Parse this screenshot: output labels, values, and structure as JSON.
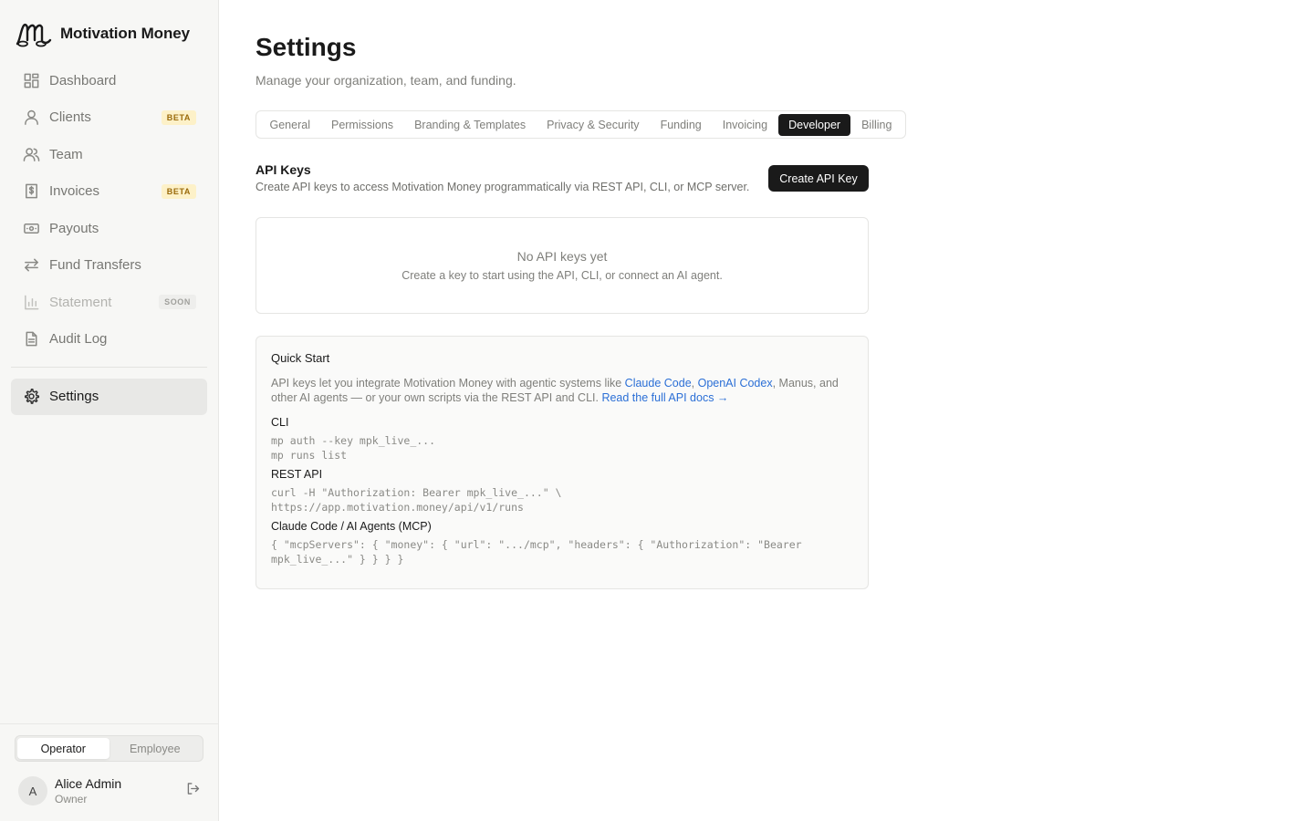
{
  "brand": {
    "name": "Motivation Money"
  },
  "sidebar": {
    "items": [
      {
        "label": "Dashboard",
        "icon": "dashboard-grid-icon",
        "badge": ""
      },
      {
        "label": "Clients",
        "icon": "user-icon",
        "badge": "BETA"
      },
      {
        "label": "Team",
        "icon": "users-icon",
        "badge": ""
      },
      {
        "label": "Invoices",
        "icon": "invoice-dollar-icon",
        "badge": "BETA"
      },
      {
        "label": "Payouts",
        "icon": "banknote-icon",
        "badge": ""
      },
      {
        "label": "Fund Transfers",
        "icon": "transfer-arrows-icon",
        "badge": ""
      },
      {
        "label": "Statement",
        "icon": "bar-chart-icon",
        "badge": "SOON"
      },
      {
        "label": "Audit Log",
        "icon": "document-icon",
        "badge": ""
      }
    ],
    "settings": {
      "label": "Settings",
      "icon": "gear-icon"
    },
    "roles": [
      "Operator",
      "Employee"
    ],
    "selected_role": "Operator",
    "user": {
      "initial": "A",
      "name": "Alice Admin",
      "role": "Owner"
    }
  },
  "page": {
    "title": "Settings",
    "subtitle": "Manage your organization, team, and funding."
  },
  "tabs": [
    "General",
    "Permissions",
    "Branding & Templates",
    "Privacy & Security",
    "Funding",
    "Invoicing",
    "Developer",
    "Billing"
  ],
  "active_tab": "Developer",
  "api_keys": {
    "title": "API Keys",
    "subtitle": "Create API keys to access Motivation Money programmatically via REST API, CLI, or MCP server.",
    "create_label": "Create API Key",
    "empty_title": "No API keys yet",
    "empty_sub": "Create a key to start using the API, CLI, or connect an AI agent."
  },
  "quick_start": {
    "title": "Quick Start",
    "desc_1": "API keys let you integrate Motivation Money with agentic systems like ",
    "link_1": "Claude Code",
    "sep_1": ", ",
    "link_2": "OpenAI Codex",
    "desc_2": ", Manus, and other AI agents — or your own scripts via the REST API and CLI. ",
    "docs_link": "Read the full API docs →",
    "cli_label": "CLI",
    "cli_code": "mp auth --key mpk_live_...\nmp runs list",
    "rest_label": "REST API",
    "rest_code": "curl -H \"Authorization: Bearer mpk_live_...\" \\\nhttps://app.motivation.money/api/v1/runs",
    "mcp_label": "Claude Code / AI Agents (MCP)",
    "mcp_code": "{ \"mcpServers\": { \"money\": { \"url\": \".../mcp\", \"headers\": { \"Authorization\": \"Bearer mpk_live_...\" } } } }"
  },
  "colors": {
    "accent_dark": "#1a1a1a",
    "link": "#2b6fd6",
    "beta_bg": "#fdf1c8"
  }
}
